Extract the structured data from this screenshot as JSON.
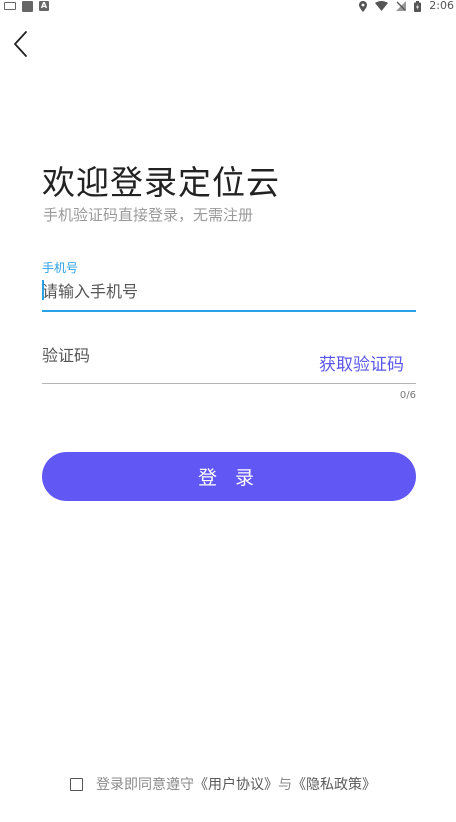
{
  "status_bar": {
    "time": "2:06",
    "icons": [
      "keyboard-icon",
      "app-square-icon",
      "a-icon",
      "location-icon",
      "wifi-icon",
      "no-signal-icon",
      "battery-icon"
    ]
  },
  "header": {
    "back_icon": "chevron-left-icon"
  },
  "title": "欢迎登录定位云",
  "subtitle": "手机验证码直接登录，无需注册",
  "phone": {
    "label": "手机号",
    "placeholder": "请输入手机号",
    "value": ""
  },
  "code": {
    "placeholder": "验证码",
    "value": "",
    "get_code_label": "获取验证码",
    "counter": "0/6"
  },
  "login_button_label": "登 录",
  "agreement": {
    "prefix": "登录即同意遵守",
    "user_agreement": "《用户协议》",
    "conjunction": "与",
    "privacy_policy": "《隐私政策》",
    "checked": false
  },
  "colors": {
    "accent": "#6157f5",
    "link": "#5b57e8",
    "focus": "#2aa0e6",
    "muted_text": "#9a9a9a"
  }
}
